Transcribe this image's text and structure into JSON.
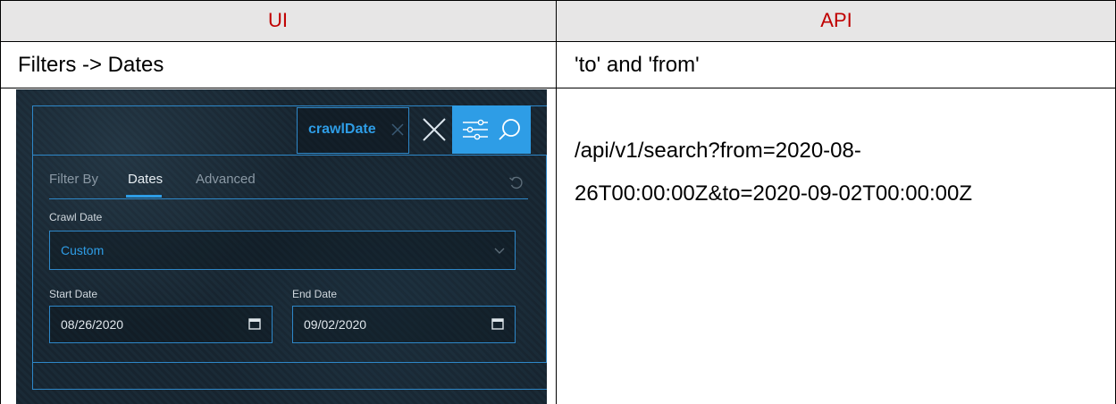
{
  "table": {
    "headers": [
      "UI",
      "API"
    ],
    "row2": {
      "ui": "Filters -> Dates",
      "api": "'to' and 'from'"
    },
    "api_lines": [
      "/api/v1/search?from=2020-08-",
      "26T00:00:00Z&to=2020-09-02T00:00:00Z"
    ]
  },
  "app": {
    "chip_label": "crawlDate",
    "tabs": [
      "Filter By",
      "Dates",
      "Advanced"
    ],
    "active_tab": "Dates",
    "crawl_date": {
      "label": "Crawl Date",
      "value": "Custom"
    },
    "start_date": {
      "label": "Start Date",
      "value": "08/26/2020"
    },
    "end_date": {
      "label": "End Date",
      "value": "09/02/2020"
    },
    "colors": {
      "accent": "#2e9de6",
      "header_text": "#c00000",
      "header_bg": "#e7e6e6"
    },
    "icons": [
      "close-icon",
      "filter-icon",
      "search-icon",
      "reset-icon",
      "chevron-down-icon",
      "calendar-icon"
    ]
  }
}
